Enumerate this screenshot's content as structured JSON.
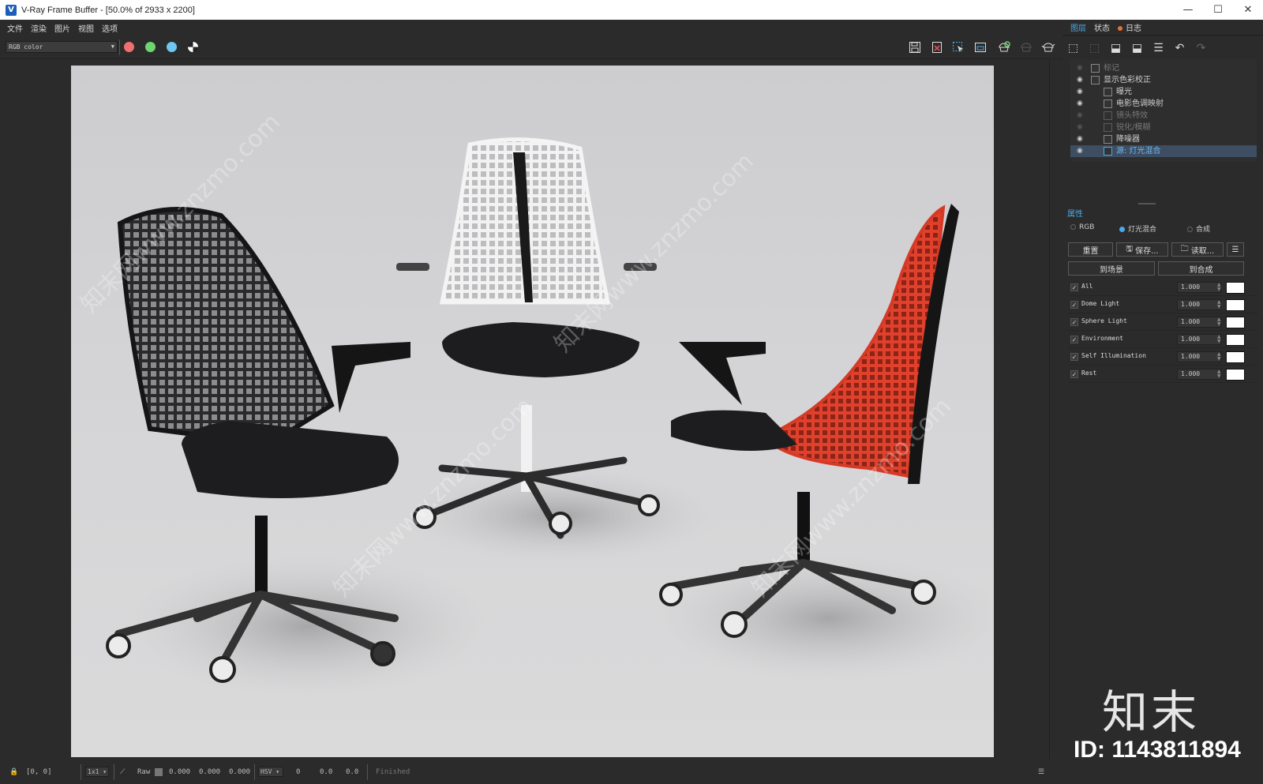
{
  "window": {
    "title": "V-Ray Frame Buffer - [50.0% of 2933 x 2200]",
    "controls": {
      "minimize": "—",
      "maximize": "☐",
      "close": "✕"
    }
  },
  "menu": [
    "文件",
    "渲染",
    "图片",
    "视图",
    "选项"
  ],
  "toolbar": {
    "channel_select": "RGB color",
    "channel_buttons": [
      {
        "name": "red-channel",
        "color": "#f07070"
      },
      {
        "name": "green-channel",
        "color": "#6fd56f"
      },
      {
        "name": "blue-channel",
        "color": "#6fc6f0"
      }
    ],
    "tools": [
      "save-icon",
      "clear-icon",
      "region-render-icon",
      "track-mouse-icon",
      "render-icon",
      "stop-icon",
      "teapot-icon"
    ]
  },
  "right_panel": {
    "tabs": [
      "图层",
      "状态",
      "日志"
    ],
    "layers": [
      {
        "name": "标记",
        "visible": false,
        "dim": true
      },
      {
        "name": "显示色彩校正",
        "visible": true,
        "dim": false
      },
      {
        "name": "曝光",
        "visible": true,
        "dim": false
      },
      {
        "name": "电影色调映射",
        "visible": true,
        "dim": false
      },
      {
        "name": "镜头特效",
        "visible": false,
        "dim": true
      },
      {
        "name": "锐化/模糊",
        "visible": false,
        "dim": true
      },
      {
        "name": "降噪器",
        "visible": true,
        "dim": false
      },
      {
        "name": "源: 灯光混合",
        "visible": true,
        "dim": false,
        "selected": true
      }
    ],
    "properties_title": "属性",
    "modes": [
      {
        "label": "RGB",
        "on": false
      },
      {
        "label": "灯光混合",
        "on": true
      },
      {
        "label": "合成",
        "on": false
      }
    ],
    "buttons": {
      "reset": "重置",
      "save": "保存...",
      "load": "读取...",
      "to_scene": "到场景",
      "to_composite": "到合成"
    },
    "lights": [
      {
        "name": "All",
        "value": "1.000"
      },
      {
        "name": "Dome Light",
        "value": "1.000"
      },
      {
        "name": "Sphere Light",
        "value": "1.000"
      },
      {
        "name": "Environment",
        "value": "1.000"
      },
      {
        "name": "Self Illumination",
        "value": "1.000"
      },
      {
        "name": "Rest",
        "value": "1.000"
      }
    ]
  },
  "statusbar": {
    "coords": "[0, 0]",
    "zoom": "1x1",
    "mode": "Raw",
    "r": "0.000",
    "g": "0.000",
    "b": "0.000",
    "color_space": "HSV",
    "h": "0",
    "s": "0.0",
    "v": "0.0",
    "status": "Finished"
  },
  "watermark": {
    "logo": "知末",
    "id": "ID: 1143811894",
    "text": "知末网www.znzmo.com"
  }
}
